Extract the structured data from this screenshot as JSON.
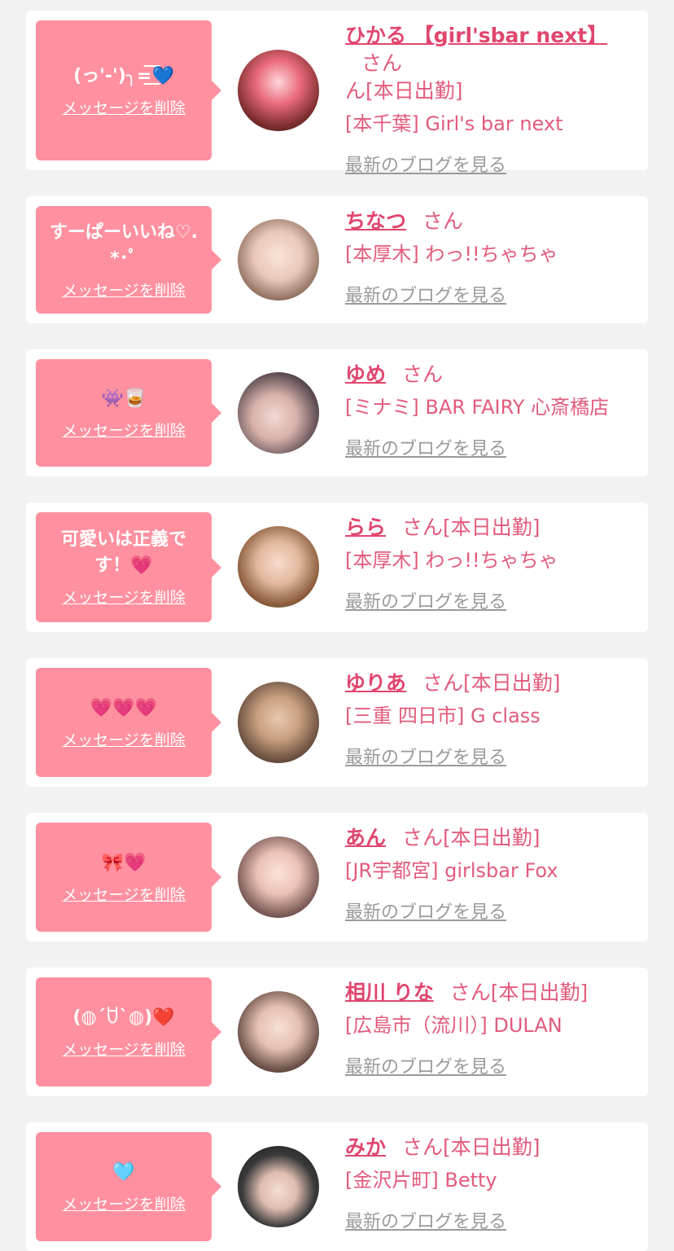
{
  "delete_label": "メッセージを削除",
  "blog_label": "最新のブログを見る",
  "san_label": "さん",
  "cards": [
    {
      "message": "(っ'-')╮=͟͟͞͞💙",
      "name": "ひかる 【girl'sbar next】",
      "tag": "ん[本日出勤]",
      "shop": "[本千葉] Girl's bar next"
    },
    {
      "message": "すーぱーいいね♡.*･ﾟ",
      "name": "ちなつ",
      "tag": "",
      "shop": "[本厚木] わっ!!ちゃちゃ"
    },
    {
      "message": "👾🥃",
      "name": "ゆめ",
      "tag": "",
      "shop": "[ミナミ] BAR FAIRY 心斎橋店"
    },
    {
      "message": "可愛いは正義です！💗",
      "name": "らら",
      "tag": "[本日出勤]",
      "shop": "[本厚木] わっ!!ちゃちゃ"
    },
    {
      "message": "💗💗💗",
      "name": "ゆりあ",
      "tag": "[本日出勤]",
      "shop": "[三重 四日市] G class"
    },
    {
      "message": "🎀💗",
      "name": "あん",
      "tag": "[本日出勤]",
      "shop": "[JR宇都宮] girlsbar Fox"
    },
    {
      "message": "(◍´ꇴ`◍)❤️",
      "name": "相川 りな",
      "tag": "[本日出勤]",
      "shop": "[広島市（流川）] DULAN"
    },
    {
      "message": "🩵",
      "name": "みか",
      "tag": "[本日出勤]",
      "shop": "[金沢片町] Betty"
    }
  ],
  "colors": {
    "bubble": "#ff909f",
    "accent": "#e0466e",
    "text": "#e25b7c",
    "link_gray": "#9a9a9a",
    "background": "#f2f2f2"
  }
}
